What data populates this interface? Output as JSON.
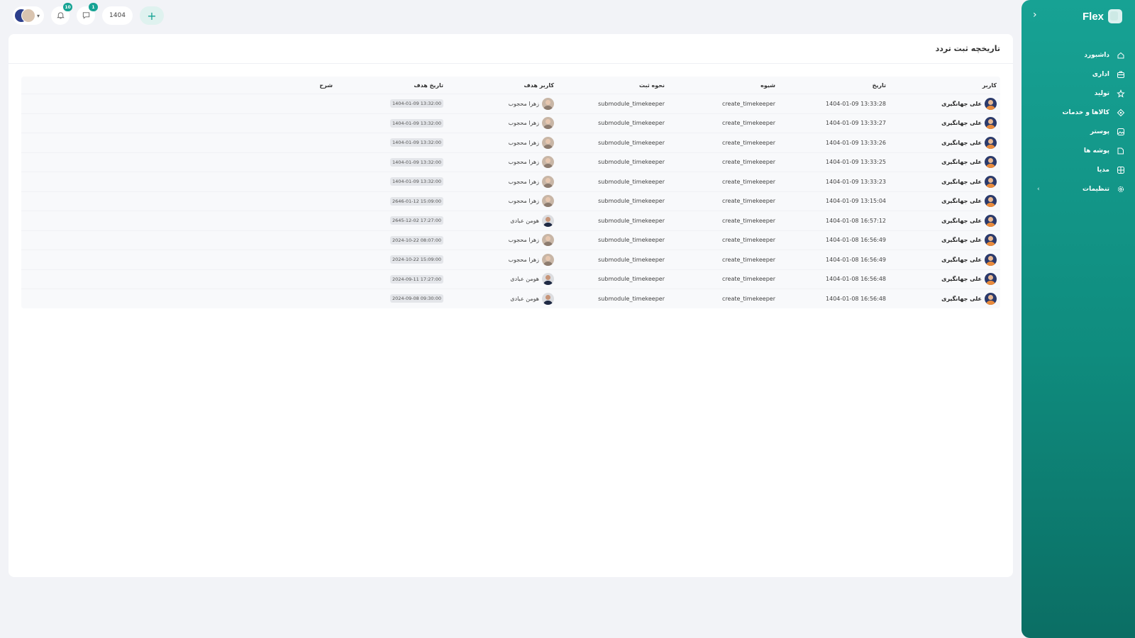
{
  "brand": {
    "name": "Flex"
  },
  "sidebar": {
    "items": [
      {
        "label": "داشبورد",
        "icon": "home-icon"
      },
      {
        "label": "اداری",
        "icon": "briefcase-icon"
      },
      {
        "label": "تولید",
        "icon": "production-icon"
      },
      {
        "label": "کالاها و خدمات",
        "icon": "box-icon"
      },
      {
        "label": "پوستر",
        "icon": "image-icon"
      },
      {
        "label": "پوشه ها",
        "icon": "folder-icon"
      },
      {
        "label": "مدیا",
        "icon": "media-icon"
      },
      {
        "label": "تنظیمات",
        "icon": "gear-icon"
      }
    ]
  },
  "topbar": {
    "notifications_count": "10",
    "messages_count": "1",
    "year": "1404",
    "add_label": "+"
  },
  "page": {
    "title": "تاریخچه ثبت تردد"
  },
  "table": {
    "headers": {
      "user": "کاربر",
      "date": "تاریخ",
      "method": "شیوه",
      "registration": "نحوه ثبت",
      "target_user": "کاربر هدف",
      "target_date": "تاریخ هدف",
      "description": "شرح"
    },
    "rows": [
      {
        "user": "علی جهانگیری",
        "date": "1404-01-09 13:33:28",
        "method": "create_timekeeper",
        "registration": "submodule_timekeeper",
        "target_user": "زهرا محجوب",
        "target_date": "1404-01-09 13:32:00",
        "description": ""
      },
      {
        "user": "علی جهانگیری",
        "date": "1404-01-09 13:33:27",
        "method": "create_timekeeper",
        "registration": "submodule_timekeeper",
        "target_user": "زهرا محجوب",
        "target_date": "1404-01-09 13:32:00",
        "description": ""
      },
      {
        "user": "علی جهانگیری",
        "date": "1404-01-09 13:33:26",
        "method": "create_timekeeper",
        "registration": "submodule_timekeeper",
        "target_user": "زهرا محجوب",
        "target_date": "1404-01-09 13:32:00",
        "description": ""
      },
      {
        "user": "علی جهانگیری",
        "date": "1404-01-09 13:33:25",
        "method": "create_timekeeper",
        "registration": "submodule_timekeeper",
        "target_user": "زهرا محجوب",
        "target_date": "1404-01-09 13:32:00",
        "description": ""
      },
      {
        "user": "علی جهانگیری",
        "date": "1404-01-09 13:33:23",
        "method": "create_timekeeper",
        "registration": "submodule_timekeeper",
        "target_user": "زهرا محجوب",
        "target_date": "1404-01-09 13:32:00",
        "description": ""
      },
      {
        "user": "علی جهانگیری",
        "date": "1404-01-09 13:15:04",
        "method": "create_timekeeper",
        "registration": "submodule_timekeeper",
        "target_user": "زهرا محجوب",
        "target_date": "2646-01-12 15:09:00",
        "description": ""
      },
      {
        "user": "علی جهانگیری",
        "date": "1404-01-08 16:57:12",
        "method": "create_timekeeper",
        "registration": "submodule_timekeeper",
        "target_user": "هومن عبادی",
        "target_date": "2645-12-02 17:27:00",
        "description": ""
      },
      {
        "user": "علی جهانگیری",
        "date": "1404-01-08 16:56:49",
        "method": "create_timekeeper",
        "registration": "submodule_timekeeper",
        "target_user": "زهرا محجوب",
        "target_date": "2024-10-22 08:07:00",
        "description": ""
      },
      {
        "user": "علی جهانگیری",
        "date": "1404-01-08 16:56:49",
        "method": "create_timekeeper",
        "registration": "submodule_timekeeper",
        "target_user": "زهرا محجوب",
        "target_date": "2024-10-22 15:09:00",
        "description": ""
      },
      {
        "user": "علی جهانگیری",
        "date": "1404-01-08 16:56:48",
        "method": "create_timekeeper",
        "registration": "submodule_timekeeper",
        "target_user": "هومن عبادی",
        "target_date": "2024-09-11 17:27:00",
        "description": ""
      },
      {
        "user": "علی جهانگیری",
        "date": "1404-01-08 16:56:48",
        "method": "create_timekeeper",
        "registration": "submodule_timekeeper",
        "target_user": "هومن عبادی",
        "target_date": "2024-09-08 09:30:00",
        "description": ""
      }
    ]
  },
  "colors": {
    "accent": "#16a394",
    "sidebar_top": "#17a294",
    "sidebar_bottom": "#0b6e64",
    "background": "#f2f3f7"
  }
}
